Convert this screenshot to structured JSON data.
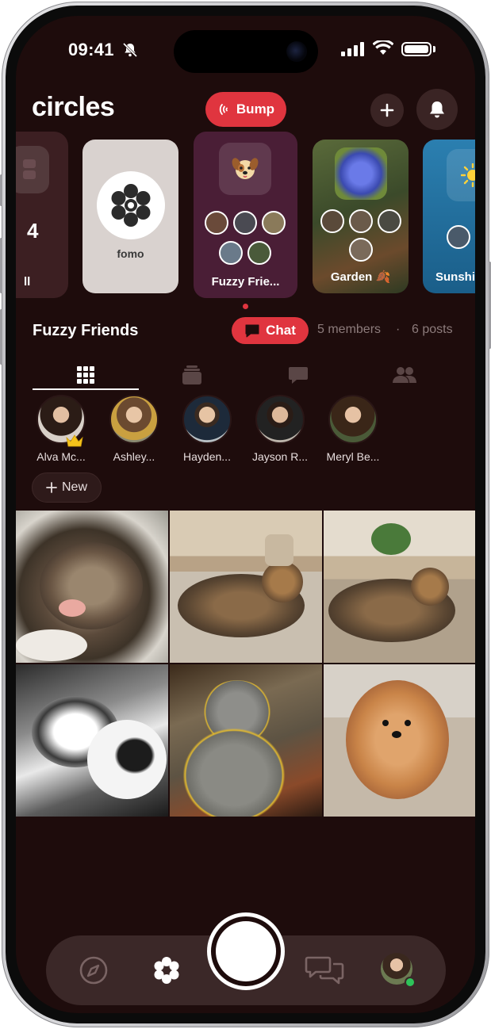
{
  "status_bar": {
    "time": "09:41"
  },
  "header": {
    "logo": "circles",
    "bump_label": "Bump"
  },
  "circles": {
    "partial_label": "ll",
    "fomo_label": "fomo",
    "active_label": "Fuzzy Frie...",
    "garden_label": "Garden 🍂",
    "sunshine_label": "Sunshi"
  },
  "circle_info": {
    "title": "Fuzzy Friends",
    "chat_label": "Chat",
    "members": "5 members",
    "separator": "·",
    "posts": "6 posts"
  },
  "tabs": [
    {
      "name": "grid",
      "icon": "grid-icon",
      "active": true
    },
    {
      "name": "stack",
      "icon": "stack-icon",
      "active": false
    },
    {
      "name": "chat",
      "icon": "chat-bubble-icon",
      "active": false
    },
    {
      "name": "members",
      "icon": "people-icon",
      "active": false
    }
  ],
  "members": [
    {
      "name": "Alva Mc...",
      "owner": true,
      "color": "#3a2a22"
    },
    {
      "name": "Ashley...",
      "owner": false,
      "color": "#8a7a5a"
    },
    {
      "name": "Hayden...",
      "owner": false,
      "color": "#6a7a8a"
    },
    {
      "name": "Jayson R...",
      "owner": false,
      "color": "#4a3a32"
    },
    {
      "name": "Meryl Be...",
      "owner": false,
      "color": "#4a5a3a"
    }
  ],
  "new_button": {
    "label": "New",
    "icon": "plus-icon"
  },
  "dock": {
    "items": [
      "compass-icon",
      "circles-icon",
      "camera-shutter",
      "chats-icon",
      "profile-avatar"
    ]
  },
  "colors": {
    "background": "#1e0c0c",
    "accent": "#e0353f",
    "active_circle": "#4a1e36",
    "online": "#2ec35a"
  }
}
